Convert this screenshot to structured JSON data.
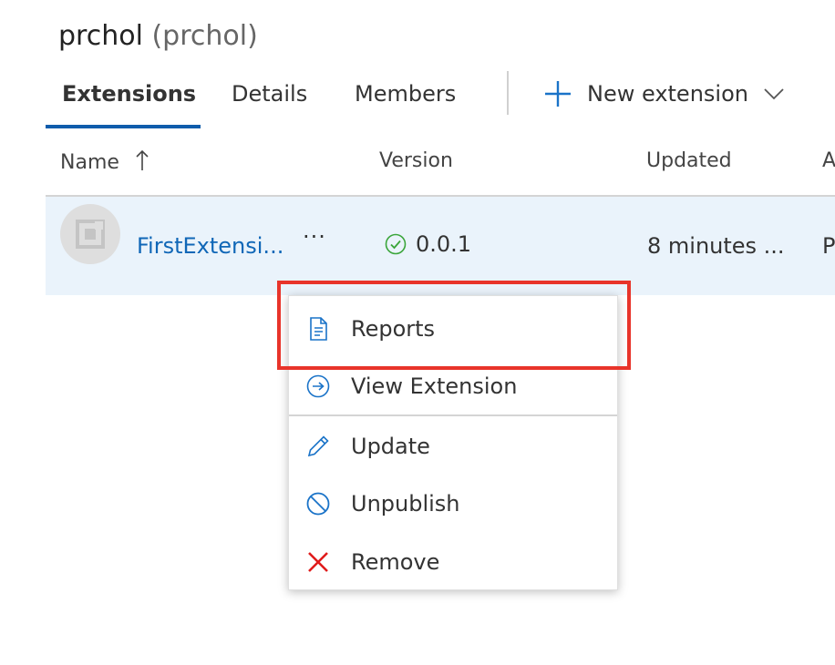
{
  "page": {
    "title": "prchol",
    "title_sub": "(prchol)"
  },
  "tabs": [
    {
      "label": "Extensions",
      "active": true
    },
    {
      "label": "Details",
      "active": false
    },
    {
      "label": "Members",
      "active": false
    }
  ],
  "toolbar": {
    "new_extension_label": "New extension"
  },
  "table": {
    "columns": [
      "Name",
      "Version",
      "Updated",
      "A"
    ],
    "rows": [
      {
        "name": "FirstExtensi...",
        "more": "···",
        "version": "0.0.1",
        "version_status": "success",
        "updated": "8 minutes ...",
        "author": "P"
      }
    ]
  },
  "context_menu": {
    "items": [
      {
        "label": "Reports",
        "icon": "report-icon"
      },
      {
        "label": "View Extension",
        "icon": "view-arrow-icon"
      },
      {
        "label": "Update",
        "icon": "pencil-icon"
      },
      {
        "label": "Unpublish",
        "icon": "blocked-icon"
      },
      {
        "label": "Remove",
        "icon": "remove-x-icon"
      }
    ]
  },
  "colors": {
    "accent": "#0f5cab",
    "link": "#1067b7",
    "selected_row": "#eaf3fb",
    "success": "#3aa53a",
    "danger": "#e01b1b",
    "highlight_box": "#e8342a"
  }
}
